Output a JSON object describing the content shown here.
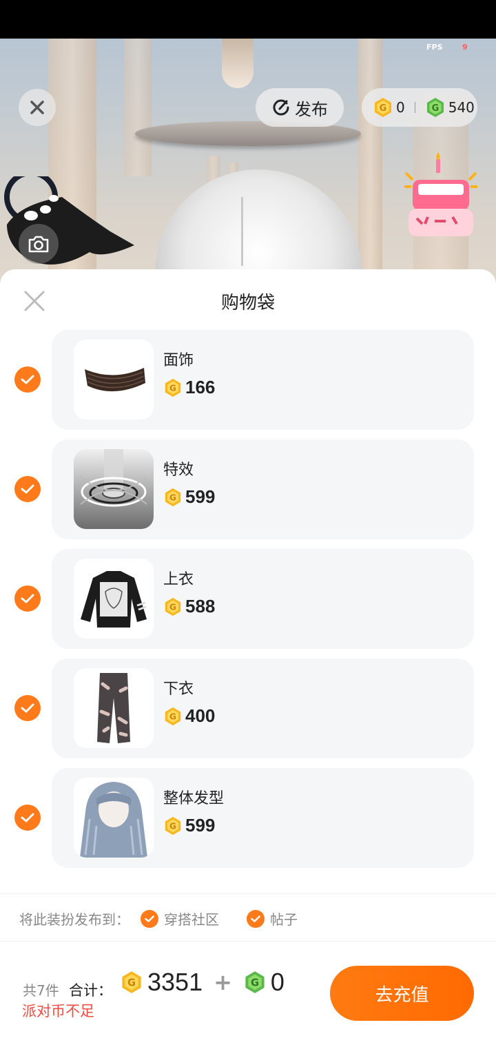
{
  "hud": {
    "fps_label": "FPS",
    "fps_value": "9",
    "publish_label": "发布",
    "gold_coins": "0",
    "green_coins": "540"
  },
  "sheet": {
    "title": "购物袋",
    "items": [
      {
        "name": "面饰",
        "price": "166",
        "checked": true
      },
      {
        "name": "特效",
        "price": "599",
        "checked": true
      },
      {
        "name": "上衣",
        "price": "588",
        "checked": true
      },
      {
        "name": "下衣",
        "price": "400",
        "checked": true
      },
      {
        "name": "整体发型",
        "price": "599",
        "checked": true
      }
    ],
    "publish_to_label": "将此装扮发布到：",
    "publish_options": [
      {
        "label": "穿搭社区",
        "checked": true
      },
      {
        "label": "帖子",
        "checked": true
      }
    ],
    "footer": {
      "count_label": "共7件",
      "total_label": "合计：",
      "gold_total": "3351",
      "green_total": "0",
      "warning": "派对币不足",
      "recharge_label": "去充值"
    }
  },
  "colors": {
    "accent": "#ff7a1a",
    "warning": "#f04b3f",
    "gold_coin": "#f5b820",
    "green_coin": "#5bb84a"
  }
}
